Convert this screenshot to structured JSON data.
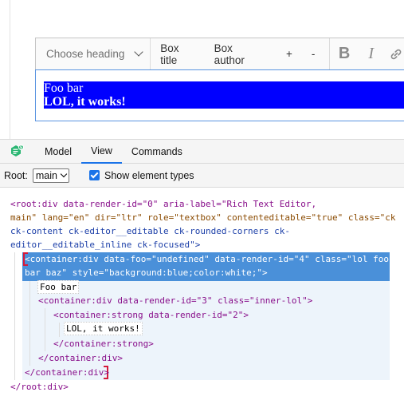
{
  "toolbar": {
    "heading_dropdown": "Choose heading",
    "box_title": "Box title",
    "box_author": "Box author",
    "plus": "+",
    "minus": "-",
    "bold": "B",
    "italic": "I",
    "link_icon": "link-icon"
  },
  "editor": {
    "line1": "Foo bar",
    "line2": "LOL, it works!",
    "box_background": "#0000ff",
    "box_text_color": "#ffffff"
  },
  "inspector": {
    "tabs": [
      "Model",
      "View",
      "Commands"
    ],
    "active_tab": "View",
    "root_label": "Root:",
    "root_value": "main",
    "show_types_label": "Show element types",
    "show_types_checked": true,
    "tree": {
      "root_open_1": "<root:div data-render-id=\"0\" aria-label=\"Rich Text Editor,",
      "root_open_2": "main\" lang=\"en\" dir=\"ltr\" role=\"textbox\" contenteditable=\"true\" class=\"ck",
      "root_open_3": "ck-content ck-editor__editable ck-rounded-corners ck-",
      "root_open_4": "editor__editable_inline ck-focused\">",
      "container_open_1": "<container:div data-foo=\"undefined\" data-render-id=\"4\" class=\"lol foo",
      "container_open_2": "bar baz\" style=\"background:blue;color:white;\">",
      "text_foo": "Foo bar",
      "inner_open": "<container:div data-render-id=\"3\" class=\"inner-lol\">",
      "strong_open": "<container:strong data-render-id=\"2\">",
      "text_lol": "LOL, it works!",
      "strong_close": "</container:strong>",
      "inner_close": "</container:div>",
      "container_close": "</container:div>",
      "root_close": "</root:div>"
    }
  }
}
